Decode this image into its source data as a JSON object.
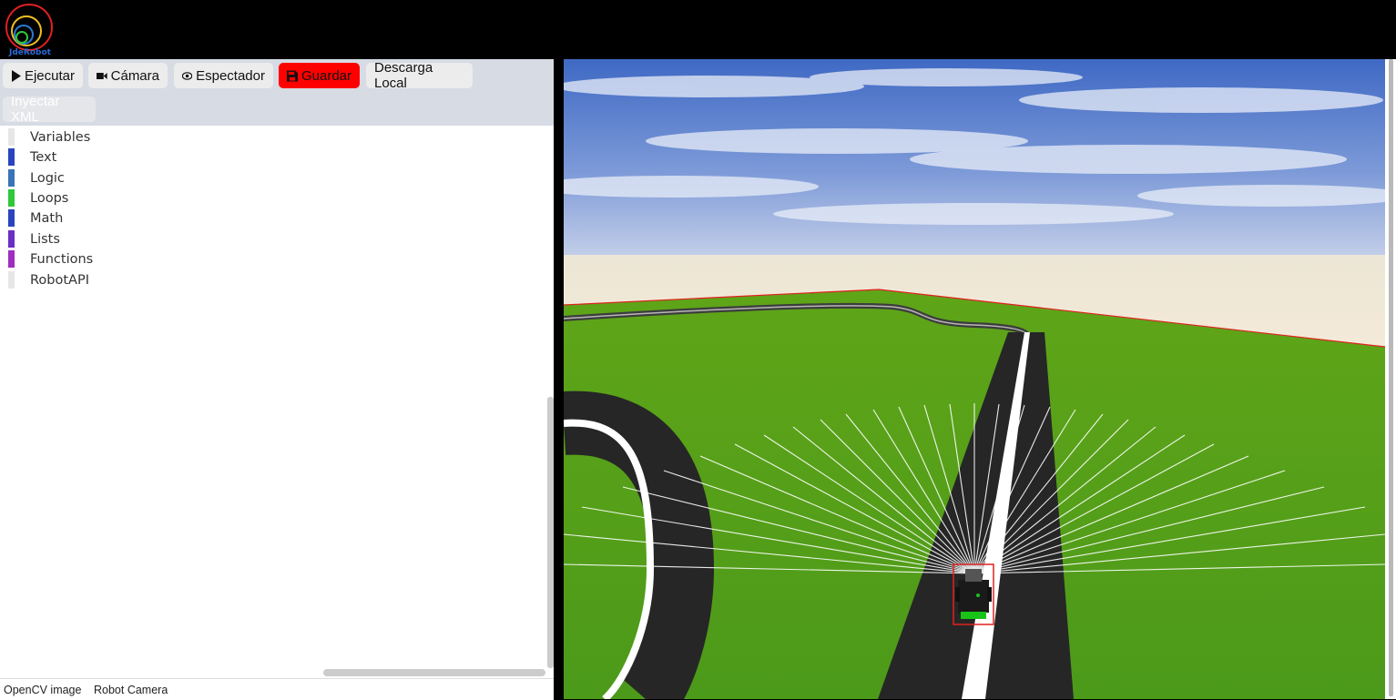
{
  "logo": {
    "text": "JdeRobot"
  },
  "toolbar": {
    "run_label": "Ejecutar",
    "camera_label": "Cámara",
    "spectator_label": "Espectador",
    "save_label": "Guardar",
    "download_label": "Descarga Local",
    "inject_label": "Inyectar XML"
  },
  "toolbox": {
    "categories": [
      {
        "label": "Variables",
        "color": "#e6e6e6"
      },
      {
        "label": "Text",
        "color": "#2a44bf"
      },
      {
        "label": "Logic",
        "color": "#3a73b8"
      },
      {
        "label": "Loops",
        "color": "#2ec83a"
      },
      {
        "label": "Math",
        "color": "#2a44bf"
      },
      {
        "label": "Lists",
        "color": "#6a2fc4"
      },
      {
        "label": "Functions",
        "color": "#a02ec0"
      },
      {
        "label": "RobotAPI",
        "color": "#e6e6e6"
      }
    ]
  },
  "footer": {
    "tab1": "OpenCV image",
    "tab2": "Robot Camera"
  },
  "colors": {
    "save_button": "#ff0000",
    "toolbar_bg": "#d6dbe4"
  },
  "icons": [
    "play-icon",
    "video-camera-icon",
    "eye-icon",
    "floppy-disk-icon"
  ]
}
